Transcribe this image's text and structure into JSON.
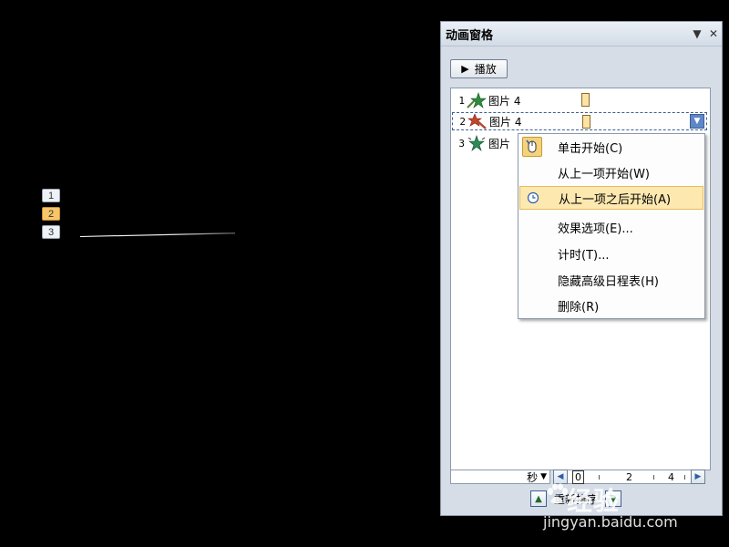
{
  "slide": {
    "markers": [
      "1",
      "2",
      "3"
    ]
  },
  "pane": {
    "title": "动画窗格",
    "dropdown_glyph": "▼",
    "close_glyph": "✕",
    "play_label": "播放",
    "items": [
      {
        "num": "1",
        "name": "图片 4",
        "effect_icon": "entrance-star-icon",
        "color": "#2e8b3e"
      },
      {
        "num": "2",
        "name": "图片 4",
        "effect_icon": "emphasis-star-icon",
        "color": "#c2462b"
      },
      {
        "num": "3",
        "name": "图片",
        "effect_icon": "exit-star-icon",
        "color": "#2e8b57"
      }
    ],
    "time_unit": "秒",
    "ruler_labels": [
      "0",
      "2",
      "4"
    ],
    "reorder_label": "重新排序"
  },
  "context_menu": {
    "items": [
      {
        "label": "单击开始(C)",
        "icon": "mouse-click-icon"
      },
      {
        "label": "从上一项开始(W)",
        "icon": ""
      },
      {
        "label": "从上一项之后开始(A)",
        "icon": "clock-icon",
        "highlighted": true
      },
      {
        "label": "效果选项(E)...",
        "icon": ""
      },
      {
        "label": "计时(T)...",
        "icon": ""
      },
      {
        "label": "隐藏高级日程表(H)",
        "icon": ""
      },
      {
        "label": "删除(R)",
        "icon": ""
      }
    ]
  },
  "watermark": {
    "logo": "经验",
    "url": "jingyan.baidu.com"
  },
  "colors": {
    "pane_bg": "#d6dde6",
    "highlight": "#fde8b0",
    "selected_marker": "#f7c56b"
  }
}
